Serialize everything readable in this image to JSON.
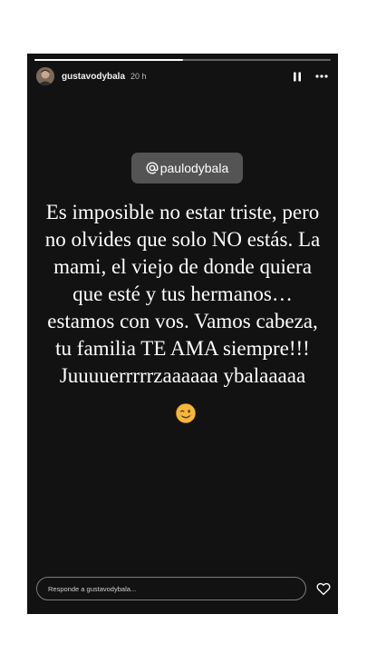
{
  "story": {
    "username": "gustavodybala",
    "time_ago": "20 h",
    "progress": 0.5,
    "mention": "paulodybala",
    "message": "Es imposible no estar triste, pero no olvides que solo NO estás. La mami, el viejo de donde quiera que esté y tus hermanos…estamos con vos. Vamos cabeza, tu familia TE AMA siempre!!! Juuuuerrrrrzaaaaaa ybalaaaaa",
    "emoji": "winking-face",
    "reply_placeholder": "Responde a gustavodybala..."
  },
  "icons": {
    "pause": "pause-icon",
    "more": "more-options-icon",
    "heart": "heart-icon",
    "mention_at": "at-sign-icon"
  },
  "colors": {
    "background": "#121212",
    "text": "#ffffff",
    "emoji": "#f5b83a"
  }
}
